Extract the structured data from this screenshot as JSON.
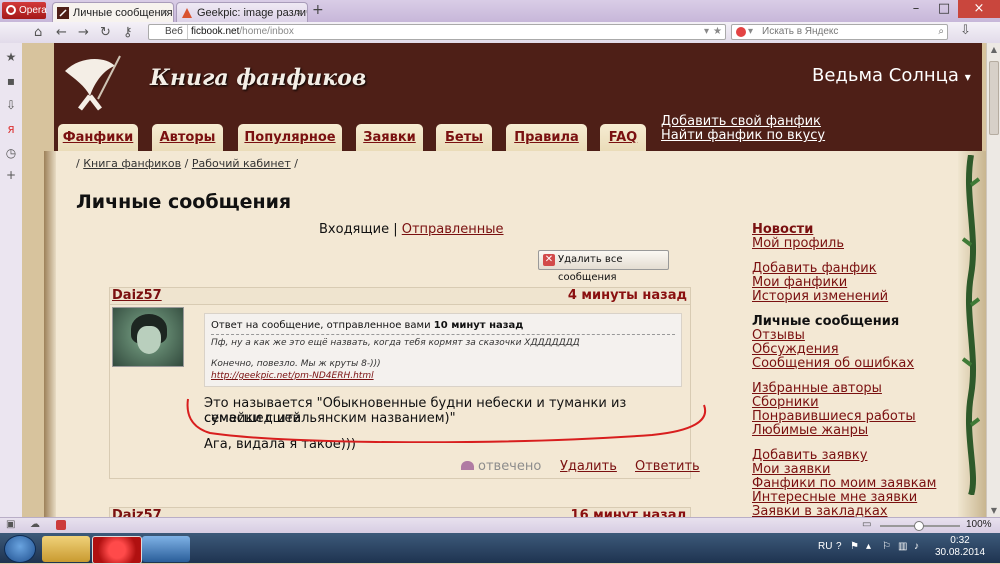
{
  "browser": {
    "menu_label": "Opera",
    "tabs": [
      {
        "title": "Личные сообщения",
        "close": "×"
      },
      {
        "title": "Geekpic: image различ",
        "close": "×"
      }
    ],
    "new_tab": "+",
    "window_controls": {
      "minimize": "–",
      "maximize": "□",
      "close": "×"
    },
    "address": {
      "prefix": "Веб",
      "domain": "ficbook.net",
      "path": "/home/inbox"
    },
    "search_placeholder": "Искать в Яндекс",
    "zoom": "100%"
  },
  "site": {
    "logo_text": "Книга фанфиков",
    "user_name": "Ведьма Солнца",
    "user_caret": "▾",
    "nav_tabs": [
      "Фанфики",
      "Авторы",
      "Популярное",
      "Заявки",
      "Беты",
      "Правила",
      "FAQ"
    ],
    "header_links": [
      "Добавить свой фанфик",
      "Найти фанфик по вкусу"
    ]
  },
  "breadcrumb": {
    "sep_start": "/",
    "items": [
      "Книга фанфиков",
      "Рабочий кабинет"
    ],
    "sep": "/"
  },
  "page_title": "Личные сообщения",
  "folders": {
    "inbox": "Входящие",
    "divider": "|",
    "sent": "Отправленные"
  },
  "delete_all_label": "Удалить все сообщения",
  "messages": [
    {
      "author": "Daiz57",
      "time": "4 минуты назад",
      "quote_header_prefix": "Ответ на сообщение, отправленное вами",
      "quote_header_time": "10 минут назад",
      "quote_line1": "Пф, ну а как же это ещё назвать, когда тебя кормят за сказочки ХДДДДДДД",
      "quote_line2": "Конечно, повезло. Мы ж круты 8-)))",
      "quote_link": "http://geekpic.net/pm-ND4ERH.html",
      "body_line1": "Это называется \"Обыкновенные будни небески и туманки из сумасшедшей",
      "body_line2": "семейки с итальянским названием)\"",
      "body_line3": "Ага, видала я такое)))",
      "status": "отвечено",
      "delete_label": "Удалить",
      "reply_label": "Ответить"
    },
    {
      "author": "Daiz57",
      "time": "16 минут назад"
    }
  ],
  "sidebar": {
    "group1": [
      "Новости",
      "Мой профиль"
    ],
    "group2": [
      "Добавить фанфик",
      "Мои фанфики",
      "История изменений"
    ],
    "group3_title": "Личные сообщения",
    "group3": [
      "Отзывы",
      "Обсуждения",
      "Сообщения об ошибках"
    ],
    "group4": [
      "Избранные авторы",
      "Сборники",
      "Понравившиеся работы",
      "Любимые жанры"
    ],
    "group5": [
      "Добавить заявку",
      "Мои заявки",
      "Фанфики по моим заявкам",
      "Интересные мне заявки",
      "Заявки в закладках"
    ]
  },
  "taskbar": {
    "lang": "RU",
    "time": "0:32",
    "date": "30.08.2014"
  },
  "colors": {
    "header_bg": "#4e1f17",
    "link": "#7a1010",
    "page_bg": "#f3e8d4",
    "annotation": "#d81e1e"
  }
}
